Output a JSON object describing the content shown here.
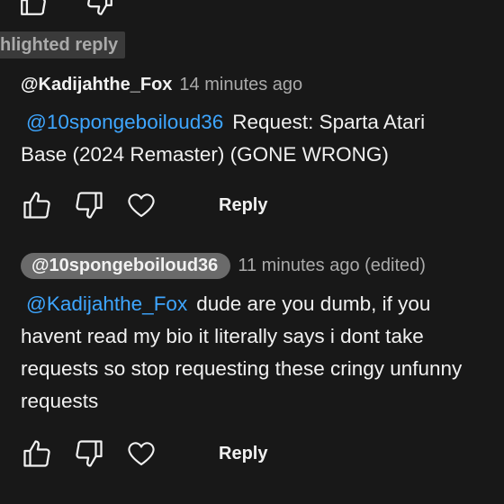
{
  "highlight": {
    "label": "hlighted reply"
  },
  "comments": [
    {
      "author": "@Kadijahthe_Fox",
      "time": "14 minutes ago",
      "mention": "@10spongeboiloud36",
      "text_lines": [
        "Request: Sparta Atari",
        "Base (2024 Remaster) (GONE WRONG)"
      ],
      "reply_label": "Reply"
    },
    {
      "author": "@10spongeboiloud36",
      "time": "11 minutes ago (edited)",
      "mention": "@Kadijahthe_Fox",
      "text_lines": [
        "dude are you dumb, if you",
        "havent read my bio it literally says i dont take",
        "requests so stop requesting these cringy unfunny",
        "requests"
      ],
      "reply_label": "Reply"
    }
  ],
  "icons": {
    "like": "thumbs-up-icon",
    "dislike": "thumbs-down-icon",
    "heart": "heart-icon"
  },
  "colors": {
    "background": "#181818",
    "mention": "#3ea6ff",
    "secondary_text": "#aaaaaa",
    "author_pill": "#6a6a6a"
  }
}
